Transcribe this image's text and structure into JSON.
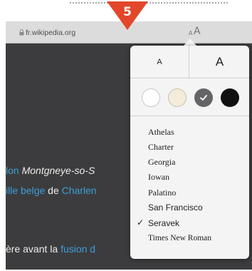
{
  "step": {
    "number": "5",
    "color": "#e2472a"
  },
  "browser": {
    "url": "fr.wikipedia.org",
    "reader_small": "A",
    "reader_big": "A"
  },
  "page_text": {
    "line1": [
      {
        "text": "lon",
        "type": "link"
      },
      {
        "text": " Montgneye-so-S",
        "type": "italic"
      }
    ],
    "line2": [
      {
        "text": "ille belge",
        "type": "link"
      },
      {
        "text": " de ",
        "type": "text"
      },
      {
        "text": "Charlen",
        "type": "link"
      }
    ],
    "line3": [
      {
        "text": "ère avant la ",
        "type": "text"
      },
      {
        "text": "fusion d",
        "type": "link"
      }
    ]
  },
  "text_size": {
    "small_label": "A",
    "large_label": "A"
  },
  "themes": [
    {
      "name": "white",
      "color": "#ffffff"
    },
    {
      "name": "sepia",
      "color": "#f3ecd9"
    },
    {
      "name": "gray",
      "color": "#646466",
      "selected": true
    },
    {
      "name": "black",
      "color": "#111111"
    }
  ],
  "fonts": [
    {
      "name": "Athelas",
      "style": "serif"
    },
    {
      "name": "Charter",
      "style": "serif"
    },
    {
      "name": "Georgia",
      "style": "serif"
    },
    {
      "name": "Iowan",
      "style": "serif"
    },
    {
      "name": "Palatino",
      "style": "serif"
    },
    {
      "name": "San Francisco",
      "style": "sans"
    },
    {
      "name": "Seravek",
      "style": "sans",
      "selected": true
    },
    {
      "name": "Times New Roman",
      "style": "serif"
    }
  ],
  "selected_mark": "✓"
}
